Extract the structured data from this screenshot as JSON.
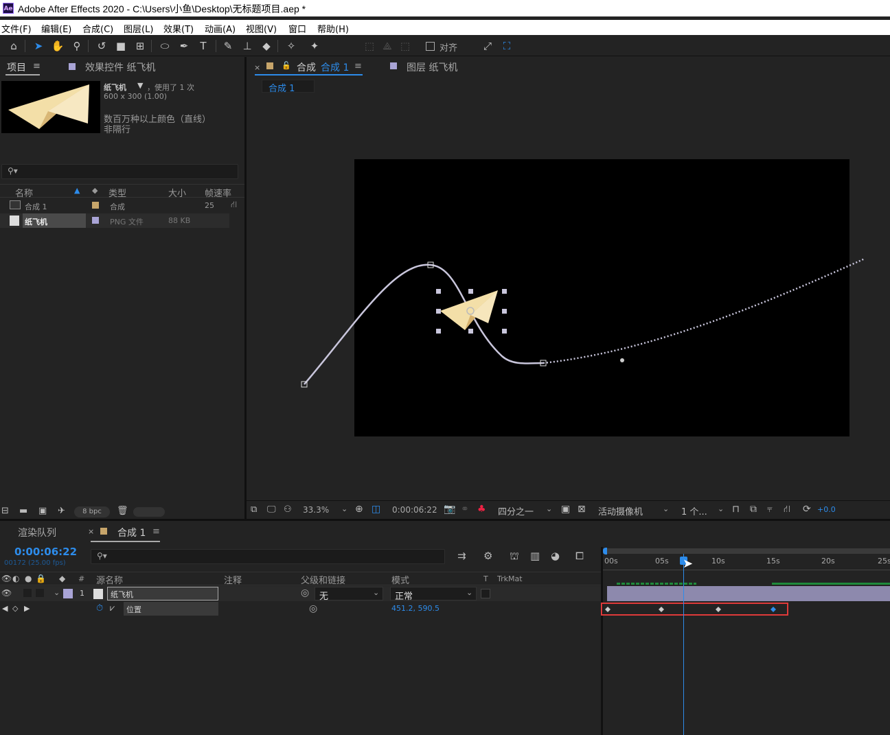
{
  "window": {
    "title": "Adobe After Effects 2020 - C:\\Users\\小鱼\\Desktop\\无标题项目.aep *",
    "logo": "Ae"
  },
  "menu": [
    "文件(F)",
    "编辑(E)",
    "合成(C)",
    "图层(L)",
    "效果(T)",
    "动画(A)",
    "视图(V)",
    "窗口",
    "帮助(H)"
  ],
  "toolbar": {
    "align_label": "对齐"
  },
  "project_panel": {
    "tab_project": "项目",
    "tab_effects": "效果控件 纸飞机",
    "asset_name": "纸飞机",
    "asset_usage": "，使用了 1 次",
    "asset_dims": "600 x 300 (1.00)",
    "asset_color": "数百万种以上颜色（直线）",
    "asset_interlace": "非隔行",
    "search_placeholder": "",
    "columns": {
      "name": "名称",
      "type": "类型",
      "size": "大小",
      "fps": "帧速率"
    },
    "rows": [
      {
        "name": "合成 1",
        "type": "合成",
        "size": "",
        "fps": "25"
      },
      {
        "name": "纸飞机",
        "type": "PNG 文件",
        "size": "88 KB",
        "fps": ""
      }
    ],
    "bpc": "8 bpc"
  },
  "comp_panel": {
    "tab_comp_prefix": "合成",
    "tab_comp_name": "合成 1",
    "tab_layer": "图层 纸飞机",
    "breadcrumb": "合成 1",
    "zoom": "33.3%",
    "timecode": "0:00:06:22",
    "resolution": "四分之一",
    "camera": "活动摄像机",
    "views": "1 个...",
    "exposure": "+0.0"
  },
  "render_tab": "渲染队列",
  "timeline": {
    "tab": "合成 1",
    "current_time": "0:00:06:22",
    "frame_info": "00172 (25.00 fps)",
    "columns": {
      "source": "源名称",
      "comment": "注释",
      "parent": "父级和链接",
      "mode": "模式",
      "t": "T",
      "trkmat": "TrkMat"
    },
    "layer": {
      "index": "1",
      "name": "纸飞机",
      "parent": "无",
      "mode": "正常"
    },
    "property": {
      "name": "位置",
      "value": "451.2, 590.5"
    },
    "ruler": [
      "00s",
      "05s",
      "10s",
      "15s",
      "20s",
      "25s"
    ]
  },
  "colors": {
    "accent": "#2d8ceb",
    "highlight_box": "#e03a3a",
    "label_tan": "#c7a56a",
    "label_lavender": "#a9a4d6"
  }
}
